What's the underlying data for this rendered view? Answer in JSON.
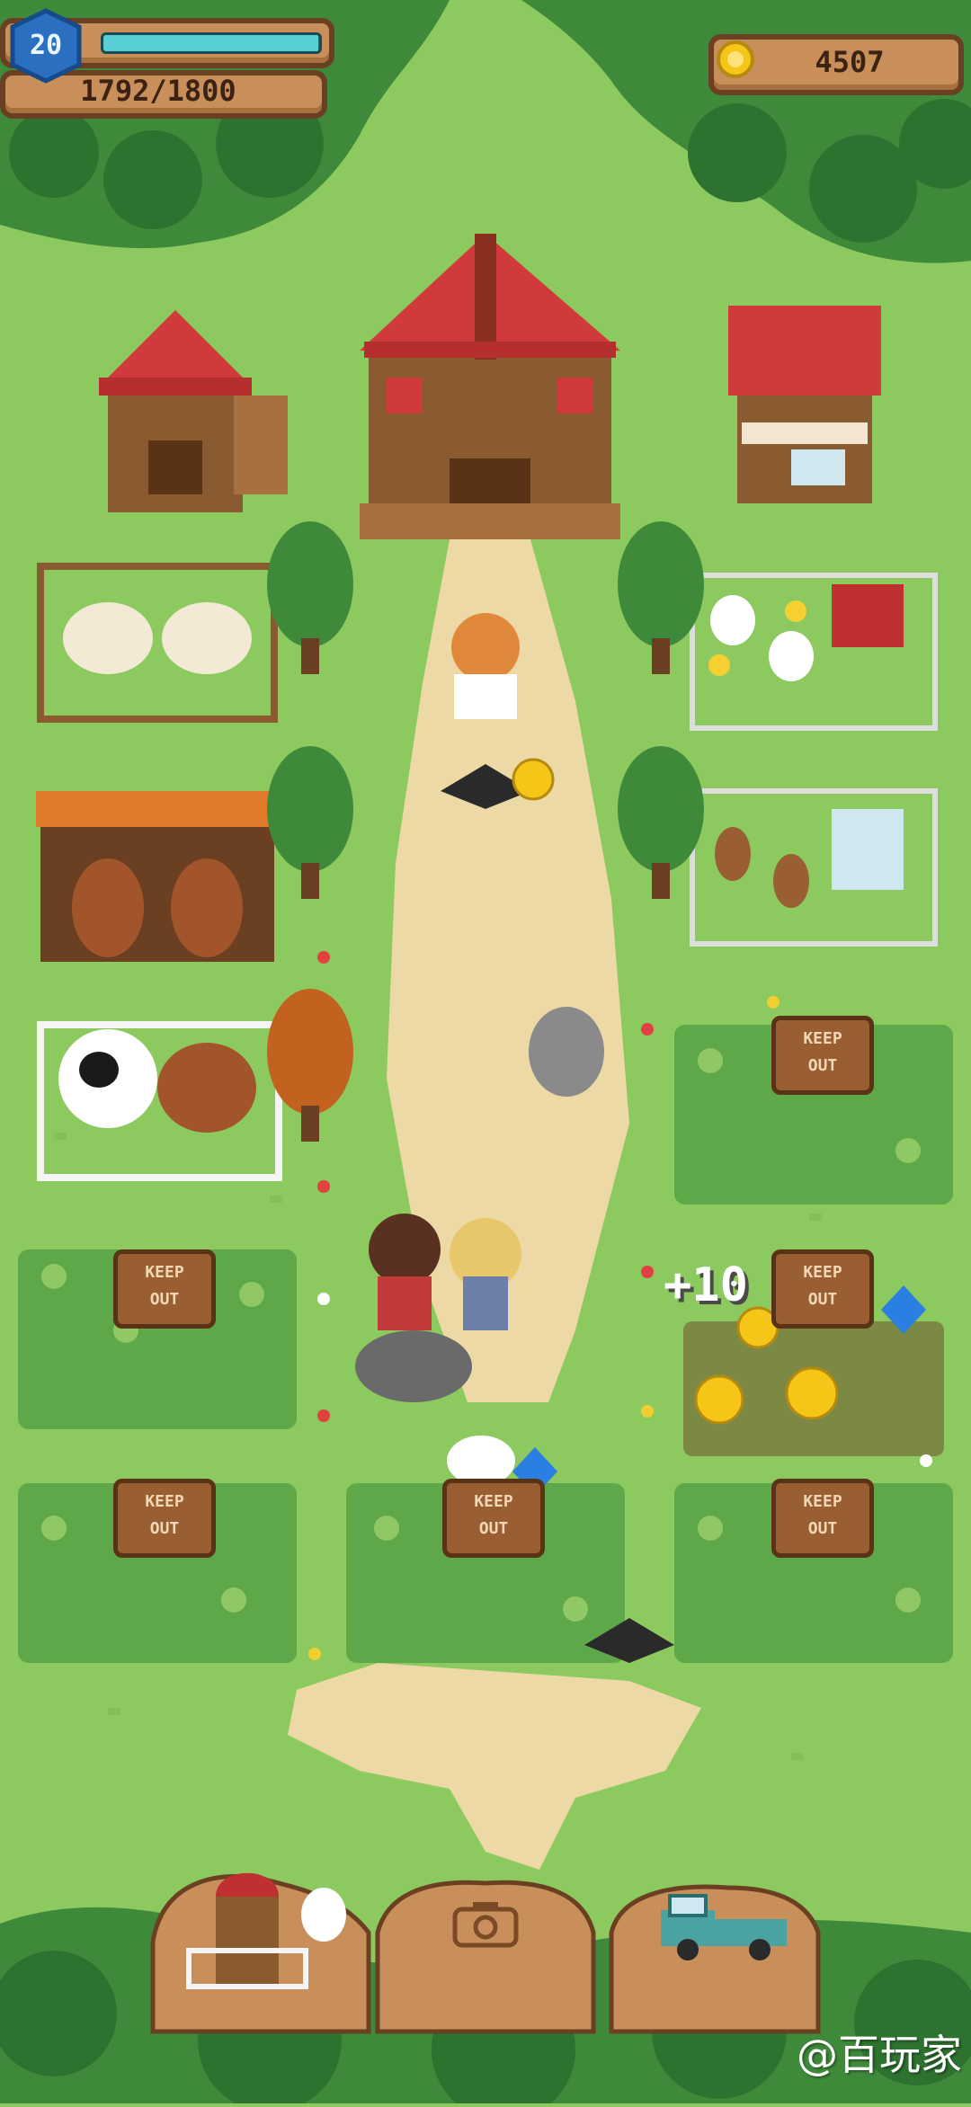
{
  "hud": {
    "level": "20",
    "xp_text": "1792/1800",
    "xp_progress": 0.996,
    "coins": "4507",
    "level_badge_color": "#2b6fc0",
    "xp_bar_color": "#56d0d6"
  },
  "floating": {
    "reward": "+10"
  },
  "signs": [
    "KEEP\nOUT",
    "KEEP\nOUT",
    "KEEP\nOUT",
    "KEEP\nOUT",
    "KEEP\nOUT",
    "KEEP\nOUT"
  ],
  "bottom_bar": {
    "left_icon": "barn-silo-icon",
    "center_icon": "camera-icon",
    "right_icon": "pickup-truck-icon"
  },
  "watermark": "@百玩家",
  "colors": {
    "grass": "#8cc95f",
    "path": "#ecd9a6",
    "roof_red": "#d13a3a",
    "wood": "#9a5e33",
    "coin": "#f5c518"
  }
}
